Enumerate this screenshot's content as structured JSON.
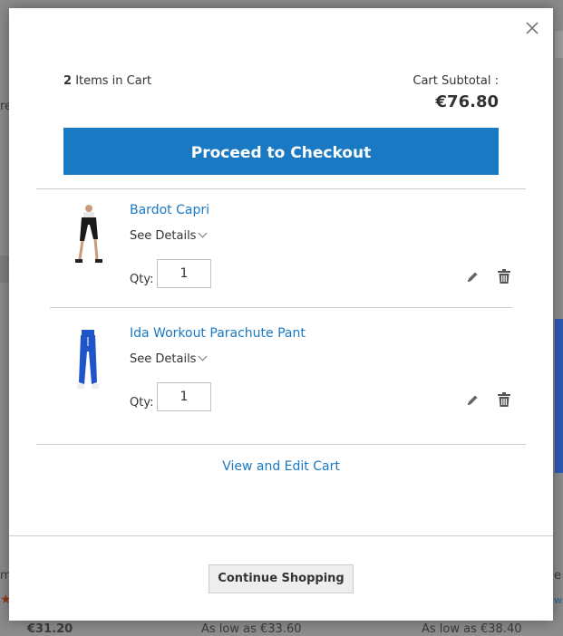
{
  "background": {
    "fragments": [
      "re",
      "m",
      "€31.20",
      "As low as €33.60",
      "As low as €38.40",
      "e",
      "ws"
    ]
  },
  "minicart": {
    "close_icon": "close-icon",
    "items_count": "2",
    "items_label": "Items in Cart",
    "subtotal_label": "Cart Subtotal :",
    "subtotal_value": "€76.80",
    "checkout_label": "Proceed to Checkout",
    "items": [
      {
        "name": "Bardot Capri",
        "see_details": "See Details",
        "qty_label": "Qty:",
        "qty": "1",
        "pants_color": "#1a1a1a",
        "pants_style": "capri"
      },
      {
        "name": "Ida Workout Parachute Pant",
        "see_details": "See Details",
        "qty_label": "Qty:",
        "qty": "1",
        "pants_color": "#1f55c9",
        "pants_style": "long"
      }
    ],
    "view_edit_label": "View and Edit Cart",
    "continue_label": "Continue Shopping"
  },
  "colors": {
    "accent": "#1979c3",
    "link": "#1979c3"
  }
}
